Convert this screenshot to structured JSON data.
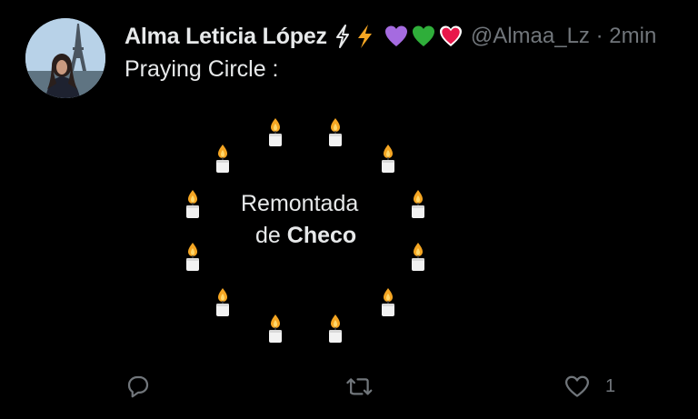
{
  "tweet": {
    "display_name": "Alma Leticia López",
    "name_emojis": [
      "bolt-outline-icon",
      "bolt-icon",
      "purple-heart-icon",
      "green-heart-icon",
      "red-heart-icon"
    ],
    "handle": "@Almaa_Lz",
    "separator": "·",
    "time": "2min",
    "text": "Praying Circle :",
    "circle": {
      "line1": "Remontada",
      "line2_prefix": "de ",
      "line2_bold": "Checo",
      "candle_count": 12
    }
  },
  "actions": {
    "reply": {
      "icon": "reply-icon",
      "count": ""
    },
    "retweet": {
      "icon": "retweet-icon",
      "count": ""
    },
    "like": {
      "icon": "heart-outline-icon",
      "count": "1"
    }
  },
  "colors": {
    "background": "#000000",
    "text_primary": "#e7e9ea",
    "text_secondary": "#71767b",
    "candle_flame": "#f5a623",
    "purple_heart": "#a56be0",
    "green_heart": "#2fae3a",
    "red_heart": "#e8174a",
    "bolt": "#f5a623"
  }
}
